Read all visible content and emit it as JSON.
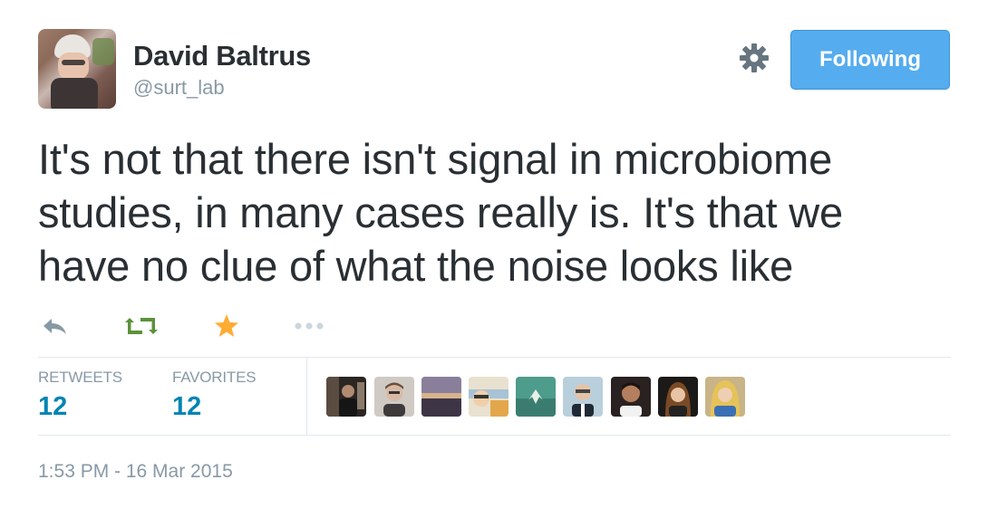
{
  "author": {
    "name": "David Baltrus",
    "handle": "@surt_lab",
    "avatar_icon": "profile-photo"
  },
  "follow_button": {
    "label": "Following",
    "color": "#55acee"
  },
  "settings_icon": "gear-icon",
  "tweet": {
    "text": "It's not that there isn't signal in microbiome studies, in many cases really is. It's that we have no clue of what the noise looks like"
  },
  "actions": [
    {
      "name": "reply",
      "icon": "reply-icon",
      "color": "#8899a6"
    },
    {
      "name": "retweet",
      "icon": "retweet-icon",
      "color": "#5c913b"
    },
    {
      "name": "favorite",
      "icon": "star-icon",
      "color": "#ffac33"
    },
    {
      "name": "more",
      "icon": "more-icon",
      "color": "#8899a6"
    }
  ],
  "stats": {
    "retweets_label": "RETWEETS",
    "retweets_count": "12",
    "favorites_label": "FAVORITES",
    "favorites_count": "12",
    "count_color": "#0084b4"
  },
  "favoriters_count": 9,
  "timestamp": "1:53 PM - 16 Mar 2015"
}
